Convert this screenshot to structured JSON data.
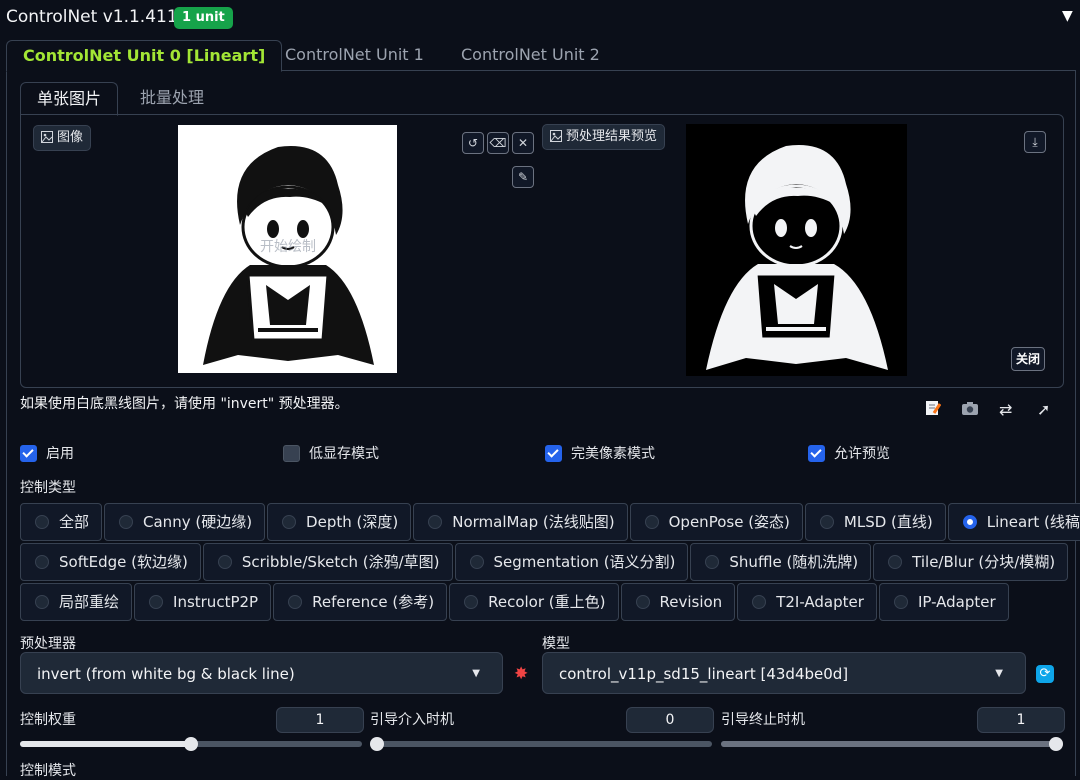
{
  "header": {
    "title": "ControlNet v1.1.411",
    "badge": "1 unit",
    "collapse_glyph": "▼"
  },
  "main_tabs": [
    {
      "label": "ControlNet Unit 0 [Lineart]",
      "active": true
    },
    {
      "label": "ControlNet Unit 1",
      "active": false
    },
    {
      "label": "ControlNet Unit 2",
      "active": false
    }
  ],
  "sub_tabs": [
    {
      "label": "单张图片",
      "active": true
    },
    {
      "label": "批量处理",
      "active": false
    }
  ],
  "input_image": {
    "label": "图像",
    "icon": "image-icon",
    "watermark": "开始绘制"
  },
  "image_tools": [
    "undo-icon",
    "eraser-icon",
    "clear-icon",
    "brush-icon"
  ],
  "preview": {
    "label": "预处理结果预览",
    "icon": "image-icon",
    "close_label": "关闭",
    "download_icon": "download-icon"
  },
  "hint": "如果使用白底黑线图片，请使用 \"invert\" 预处理器。",
  "toolbar_icons": [
    "edit-icon",
    "camera-icon",
    "swap-icon",
    "send-dimensions-icon"
  ],
  "checkboxes": [
    {
      "label": "启用",
      "checked": true
    },
    {
      "label": "低显存模式",
      "checked": false
    },
    {
      "label": "完美像素模式",
      "checked": true
    },
    {
      "label": "允许预览",
      "checked": true
    }
  ],
  "control_type": {
    "label": "控制类型",
    "rows": [
      [
        {
          "label": "全部",
          "selected": false
        },
        {
          "label": "Canny (硬边缘)",
          "selected": false
        },
        {
          "label": "Depth (深度)",
          "selected": false
        },
        {
          "label": "NormalMap (法线贴图)",
          "selected": false
        },
        {
          "label": "OpenPose (姿态)",
          "selected": false
        },
        {
          "label": "MLSD (直线)",
          "selected": false
        },
        {
          "label": "Lineart (线稿)",
          "selected": true
        }
      ],
      [
        {
          "label": "SoftEdge (软边缘)",
          "selected": false
        },
        {
          "label": "Scribble/Sketch (涂鸦/草图)",
          "selected": false
        },
        {
          "label": "Segmentation (语义分割)",
          "selected": false
        },
        {
          "label": "Shuffle (随机洗牌)",
          "selected": false
        },
        {
          "label": "Tile/Blur (分块/模糊)",
          "selected": false
        }
      ],
      [
        {
          "label": "局部重绘",
          "selected": false
        },
        {
          "label": "InstructP2P",
          "selected": false
        },
        {
          "label": "Reference (参考)",
          "selected": false
        },
        {
          "label": "Recolor (重上色)",
          "selected": false
        },
        {
          "label": "Revision",
          "selected": false
        },
        {
          "label": "T2I-Adapter",
          "selected": false
        },
        {
          "label": "IP-Adapter",
          "selected": false
        }
      ]
    ]
  },
  "preprocessor": {
    "label": "预处理器",
    "value": "invert (from white bg & black line)"
  },
  "model": {
    "label": "模型",
    "value": "control_v11p_sd15_lineart [43d4be0d]"
  },
  "sliders": [
    {
      "label": "控制权重",
      "value": "1",
      "fraction": 0.5
    },
    {
      "label": "引导介入时机",
      "value": "0",
      "fraction": 0.0
    },
    {
      "label": "引导终止时机",
      "value": "1",
      "fraction": 1.0
    }
  ],
  "control_mode": {
    "label": "控制模式"
  },
  "colors": {
    "accent": "#a3e635",
    "badge": "#16a34a",
    "checkbox": "#2563eb",
    "background": "#0b0f19"
  }
}
